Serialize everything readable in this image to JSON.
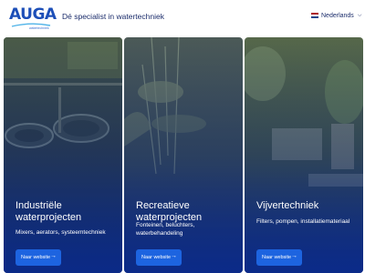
{
  "header": {
    "logo_text": "AUGA",
    "logo_subtext": "watertechniek",
    "tagline": "Dé specialist in watertechniek",
    "language": "Nederlands",
    "flag_colors": [
      "#ae1c28",
      "#ffffff",
      "#21468b"
    ]
  },
  "cards": [
    {
      "title": "Industriële waterprojecten",
      "subtitle": "Mixers, aerators, systeemtechniek",
      "button_label": "Naar website",
      "icon": "arrow-right-icon"
    },
    {
      "title": "Recreatieve waterprojecten",
      "subtitle": "Fonteinen, beluchters, waterbehandeling",
      "button_label": "Naar website",
      "icon": "arrow-right-icon"
    },
    {
      "title": "Vijvertechniek",
      "subtitle": "Filters, pompen, installatiemateriaal",
      "button_label": "Naar website",
      "icon": "arrow-right-icon"
    }
  ],
  "colors": {
    "brand_blue": "#1d4fb8",
    "button_blue": "#1d64e0",
    "text_dark": "#1b2c6b"
  }
}
